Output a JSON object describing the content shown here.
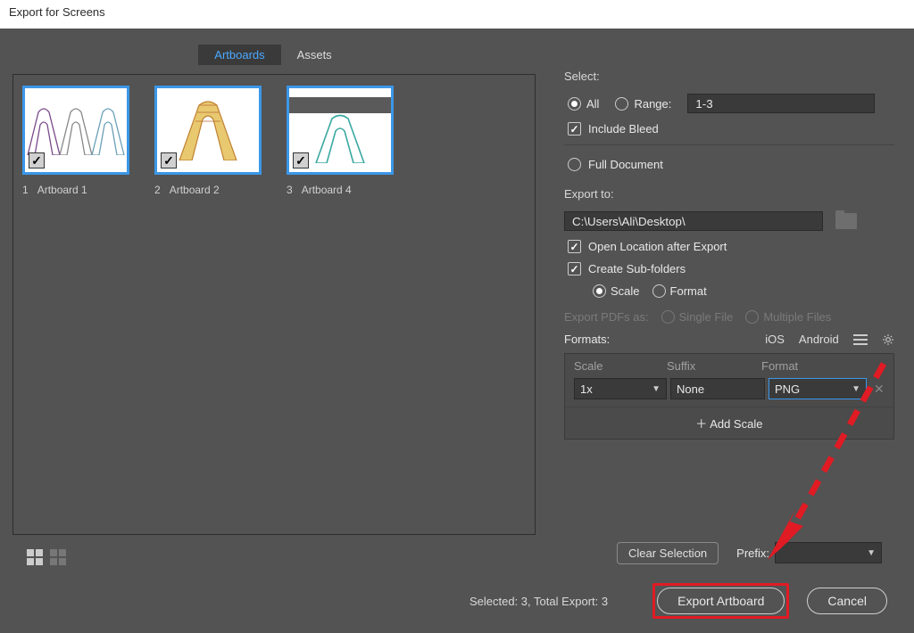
{
  "title": "Export for Screens",
  "tabs": {
    "artboards": "Artboards",
    "assets": "Assets"
  },
  "artboards": [
    {
      "num": "1",
      "name": "Artboard 1"
    },
    {
      "num": "2",
      "name": "Artboard 2"
    },
    {
      "num": "3",
      "name": "Artboard 4"
    }
  ],
  "clearSelection": "Clear Selection",
  "select": {
    "label": "Select:",
    "all": "All",
    "range": "Range:",
    "rangeValue": "1-3",
    "includeBleed": "Include Bleed",
    "fullDocument": "Full Document"
  },
  "exportTo": {
    "label": "Export to:",
    "path": "C:\\Users\\Ali\\Desktop\\",
    "openLocation": "Open Location after Export",
    "createSub": "Create Sub-folders",
    "scale": "Scale",
    "format": "Format"
  },
  "exportPdfs": {
    "label": "Export PDFs as:",
    "single": "Single File",
    "multiple": "Multiple Files"
  },
  "formats": {
    "label": "Formats:",
    "ios": "iOS",
    "android": "Android",
    "colScale": "Scale",
    "colSuffix": "Suffix",
    "colFormat": "Format",
    "scaleVal": "1x",
    "suffixVal": "None",
    "formatVal": "PNG",
    "addScale": "Add Scale"
  },
  "prefix": {
    "label": "Prefix:"
  },
  "status": "Selected: 3, Total Export: 3",
  "buttons": {
    "export": "Export Artboard",
    "cancel": "Cancel"
  }
}
